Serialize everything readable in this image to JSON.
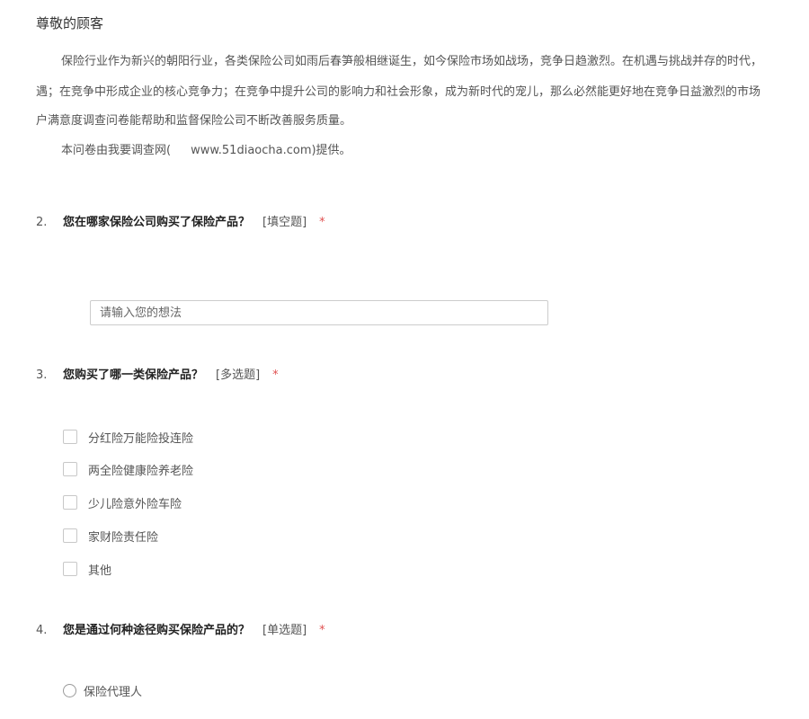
{
  "intro": {
    "greeting": "尊敬的顾客",
    "paragraph_lines": [
      "保险行业作为新兴的朝阳行业，各类保险公司如雨后春笋般相继诞生，如今保险市场如战场，竞争日趋激烈。在机遇与挑战并存的时代，",
      "遇；在竞争中形成企业的核心竞争力；在竞争中提升公司的影响力和社会形象，成为新时代的宠儿，那么必然能更好地在竞争日益激烈的市场",
      "户满意度调查问卷能帮助和监督保险公司不断改善服务质量。"
    ],
    "provider_prefix": "本问卷由我要调查网(",
    "provider_url": "www.51diaocha.com)提供。"
  },
  "questions": [
    {
      "number": "2.",
      "title": "您在哪家保险公司购买了保险产品？",
      "type": "[填空题]",
      "required": "*",
      "input_placeholder": "请输入您的想法"
    },
    {
      "number": "3.",
      "title": "您购买了哪一类保险产品？",
      "type": "[多选题]",
      "required": "*",
      "options": [
        "分红险万能险投连险",
        "两全险健康险养老险",
        "少儿险意外险车险",
        "家财险责任险",
        "其他"
      ]
    },
    {
      "number": "4.",
      "title": "您是通过何种途径购买保险产品的？",
      "type": "[单选题]",
      "required": "*",
      "options": [
        "保险代理人"
      ]
    }
  ]
}
